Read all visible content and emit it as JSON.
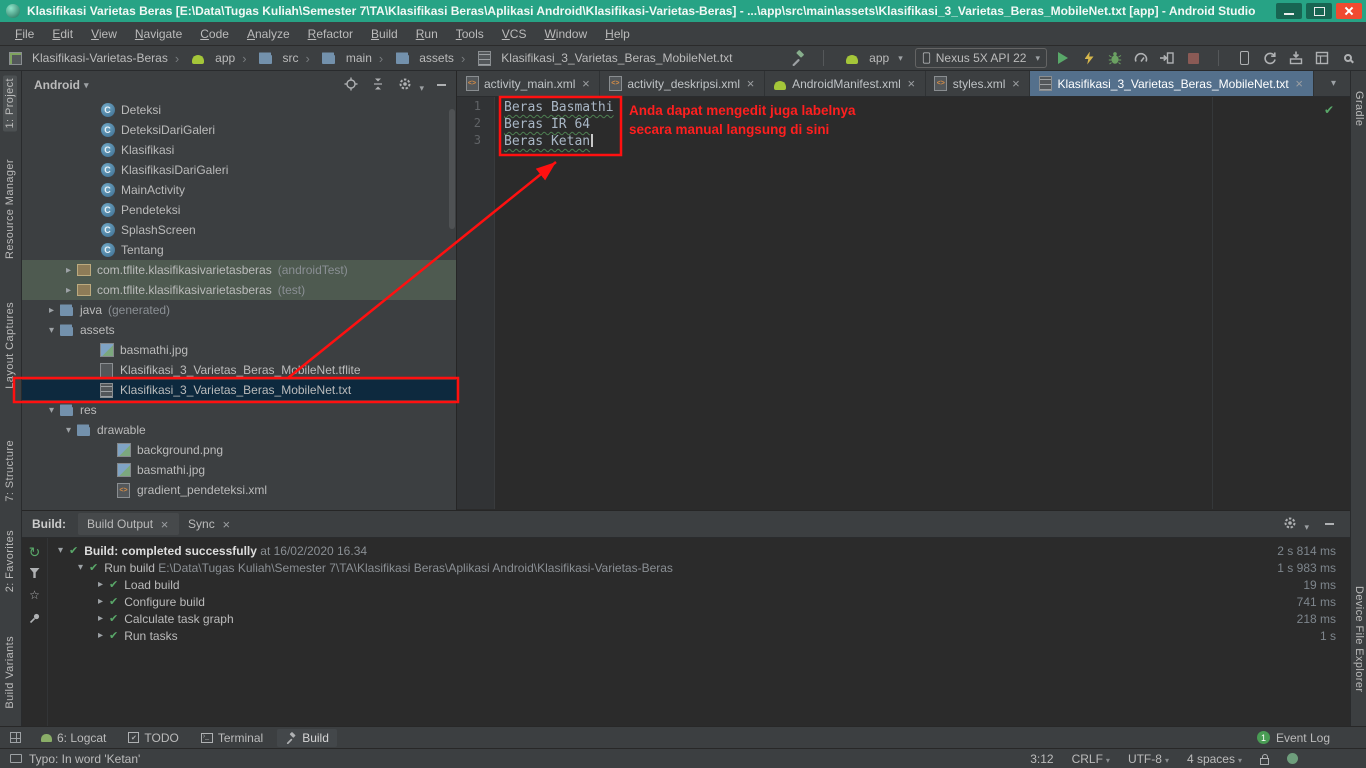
{
  "window": {
    "title": "Klasifikasi Varietas Beras [E:\\Data\\Tugas Kuliah\\Semester 7\\TA\\Klasifikasi Beras\\Aplikasi Android\\Klasifikasi-Varietas-Beras] - ...\\app\\src\\main\\assets\\Klasifikasi_3_Varietas_Beras_MobileNet.txt [app] - Android Studio"
  },
  "colors": {
    "titlebar": "#27A385",
    "annotation_red": "#FF1010",
    "success_green": "#59A869",
    "selection_blue": "#0D293E"
  },
  "menu": {
    "items": [
      "File",
      "Edit",
      "View",
      "Navigate",
      "Code",
      "Analyze",
      "Refactor",
      "Build",
      "Run",
      "Tools",
      "VCS",
      "Window",
      "Help"
    ]
  },
  "toolbar": {
    "breadcrumbs": [
      "Klasifikasi-Varietas-Beras",
      "app",
      "src",
      "main",
      "assets",
      "Klasifikasi_3_Varietas_Beras_MobileNet.txt"
    ],
    "run_config": "app",
    "device": "Nexus 5X API 22"
  },
  "stripes": {
    "left": [
      "1: Project",
      "Resource Manager",
      "Layout Captures",
      "7: Structure",
      "2: Favorites",
      "Build Variants"
    ],
    "right": [
      "Gradle",
      "Device File Explorer"
    ]
  },
  "project": {
    "mode": "Android",
    "items": [
      {
        "label": "Deteksi"
      },
      {
        "label": "DeteksiDariGaleri"
      },
      {
        "label": "Klasifikasi"
      },
      {
        "label": "KlasifikasiDariGaleri"
      },
      {
        "label": "MainActivity"
      },
      {
        "label": "Pendeteksi"
      },
      {
        "label": "SplashScreen"
      },
      {
        "label": "Tentang"
      },
      {
        "label": "com.tflite.klasifikasivarietasberas",
        "suffix": "(androidTest)"
      },
      {
        "label": "com.tflite.klasifikasivarietasberas",
        "suffix": "(test)"
      },
      {
        "label": "java",
        "suffix": "(generated)"
      },
      {
        "label": "assets"
      },
      {
        "label": "basmathi.jpg"
      },
      {
        "label": "Klasifikasi_3_Varietas_Beras_MobileNet.tflite"
      },
      {
        "label": "Klasifikasi_3_Varietas_Beras_MobileNet.txt"
      },
      {
        "label": "res"
      },
      {
        "label": "drawable"
      },
      {
        "label": "background.png"
      },
      {
        "label": "basmathi.jpg"
      },
      {
        "label": "gradient_pendeteksi.xml"
      }
    ]
  },
  "editor": {
    "tabs": [
      {
        "label": "activity_main.xml"
      },
      {
        "label": "activity_deskripsi.xml"
      },
      {
        "label": "AndroidManifest.xml"
      },
      {
        "label": "styles.xml"
      },
      {
        "label": "Klasifikasi_3_Varietas_Beras_MobileNet.txt"
      }
    ],
    "lines": [
      {
        "num": "1",
        "text": "Beras Basmathi"
      },
      {
        "num": "2",
        "text": "Beras IR 64"
      },
      {
        "num": "3",
        "text": "Beras Ketan"
      }
    ]
  },
  "annotation": {
    "line1": "Anda dapat mengedit juga labelnya",
    "line2": "secara manual langsung di sini"
  },
  "build": {
    "label": "Build:",
    "tabs": [
      "Build Output",
      "Sync"
    ],
    "rows": [
      {
        "t1": "Build: completed successfully",
        "t2": " at 16/02/2020 16.34",
        "time": "2 s 814 ms"
      },
      {
        "t1": "Run build",
        "t2": " E:\\Data\\Tugas Kuliah\\Semester 7\\TA\\Klasifikasi Beras\\Aplikasi Android\\Klasifikasi-Varietas-Beras",
        "time": "1 s 983 ms"
      },
      {
        "t1": "Load build",
        "time": "19 ms"
      },
      {
        "t1": "Configure build",
        "time": "741 ms"
      },
      {
        "t1": "Calculate task graph",
        "time": "218 ms"
      },
      {
        "t1": "Run tasks",
        "time": "1 s"
      }
    ]
  },
  "bottom": {
    "buttons": [
      "6: Logcat",
      "TODO",
      "Terminal",
      "Build"
    ],
    "badge": "1",
    "event_log": "Event Log"
  },
  "status": {
    "message": "Typo: In word 'Ketan'",
    "position": "3:12",
    "line_sep": "CRLF",
    "encoding": "UTF-8",
    "indent": "4 spaces"
  }
}
